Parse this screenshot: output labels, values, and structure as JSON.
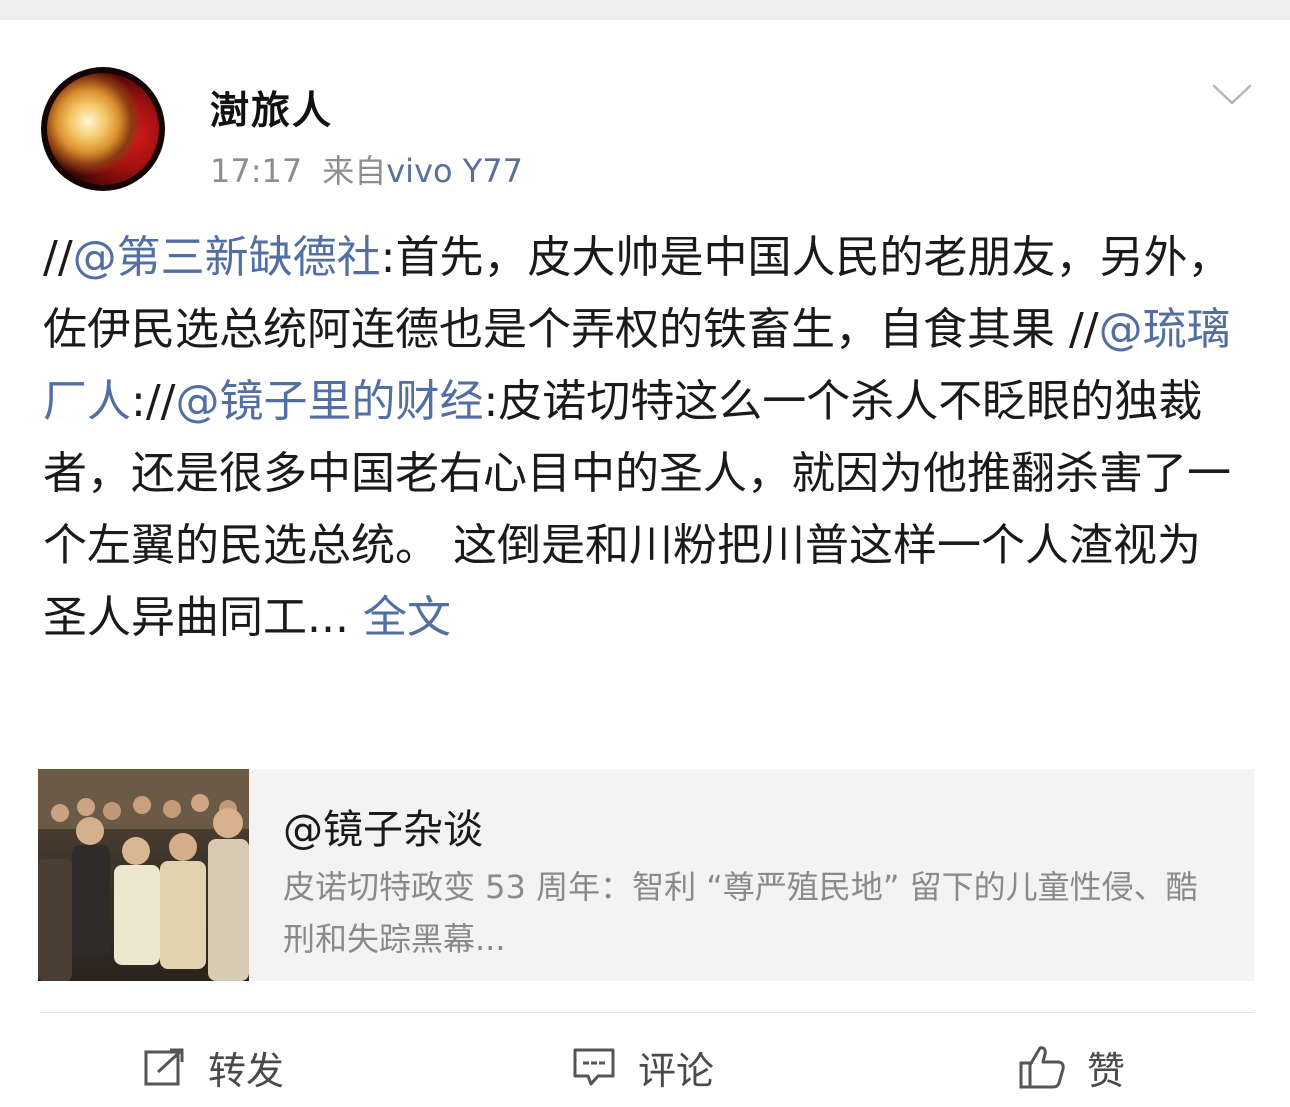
{
  "post": {
    "user_name": "澍旅人",
    "time": "17:17",
    "source_prefix": "来自",
    "device": "vivo Y77",
    "content": [
      {
        "type": "text",
        "value": "//"
      },
      {
        "type": "mention",
        "value": "@第三新缺德社"
      },
      {
        "type": "text",
        "value": ":首先，皮大帅是中国人民的老朋友，另外，佐伊民选总统阿连德也是个弄权的铁畜生，自食其果 //"
      },
      {
        "type": "mention",
        "value": "@琉璃厂人"
      },
      {
        "type": "text",
        "value": "://"
      },
      {
        "type": "mention",
        "value": "@镜子里的财经"
      },
      {
        "type": "text",
        "value": ":皮诺切特这么一个杀人不眨眼的独裁者，还是很多中国老右心目中的圣人，就因为他推翻杀害了一个左翼的民选总统。 这倒是和川粉把川普这样一个人渣视为圣人异曲同工..."
      }
    ],
    "full_text_link": "全文"
  },
  "repost_card": {
    "author": "@镜子杂谈",
    "summary": "皮诺切特政变 53 周年：智利 “尊严殖民地” 留下的儿童性侵、酷刑和失踪黑幕..."
  },
  "actions": {
    "repost_label": "转发",
    "comment_label": "评论",
    "like_label": "赞"
  },
  "icons": {
    "options": "chevron-down-icon",
    "repost": "repost-icon",
    "comment": "comment-icon",
    "like": "thumbs-up-icon"
  },
  "colors": {
    "link": "#526ea3",
    "meta": "#8e8e8e",
    "card_background": "#f3f3f3"
  }
}
